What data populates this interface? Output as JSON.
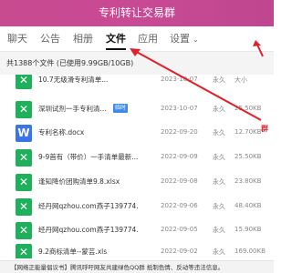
{
  "window": {
    "title": "专利转让交易群"
  },
  "tabs": [
    {
      "label": "聊天"
    },
    {
      "label": "公告"
    },
    {
      "label": "相册"
    },
    {
      "label": "文件"
    },
    {
      "label": "应用"
    },
    {
      "label": "设置"
    }
  ],
  "summary": {
    "text": "共1388个文件 (已使用9.99GB/10GB)"
  },
  "files": [
    {
      "icon": "xls-icon",
      "name": "10.7无级滑专利清单...",
      "badge": "",
      "date": "2023-10-07",
      "expiry": "永久",
      "size": "大小"
    },
    {
      "icon": "xls-icon",
      "name": "深圳试剂一手专利清...",
      "badge": "临时",
      "date": "2023-10-07",
      "expiry": "永久",
      "size": "25.50KB"
    },
    {
      "icon": "doc-icon",
      "name": "专利名称.docx",
      "badge": "",
      "date": "2022-09-20",
      "expiry": "永久",
      "size": "12.70KB"
    },
    {
      "icon": "xls-icon",
      "name": "9-9首有（带价）一手清单最新...",
      "badge": "",
      "date": "2022-09-09",
      "expiry": "永久",
      "size": "25.50KB"
    },
    {
      "icon": "xls-icon",
      "name": "逢知降价团购清单9.8.xlsx",
      "badge": "",
      "date": "2022-09-08",
      "expiry": "永久",
      "size": "23.80KB"
    },
    {
      "icon": "xls-icon",
      "name": "经丹网qzhou.com燕子139774...",
      "badge": "",
      "date": "2022-09-06",
      "expiry": "永久",
      "size": "48.40KB"
    },
    {
      "icon": "xls-icon",
      "name": "经丹网qzhou.com燕子139774...",
      "badge": "",
      "date": "2022-09-05",
      "expiry": "永久",
      "size": "15.90KB"
    },
    {
      "icon": "xls-icon",
      "name": "9.2商标清单--蒙芸.xls",
      "badge": "",
      "date": "2022-09-02",
      "expiry": "永久",
      "size": "169.00KB"
    }
  ],
  "bottom_notice": {
    "text": "【网络正能量倡议书】腾讯呼吁网友共建绿色QQ群 抵制色情、反动等违法信息。"
  },
  "annotation": {
    "side_text": "群",
    "arrow_color": "#e0202a"
  },
  "colors": {
    "title_bar": "#c94a94",
    "xls_icon": "#1fb05b",
    "doc_icon": "#3b73e8",
    "badge": "#3d8ce8"
  }
}
